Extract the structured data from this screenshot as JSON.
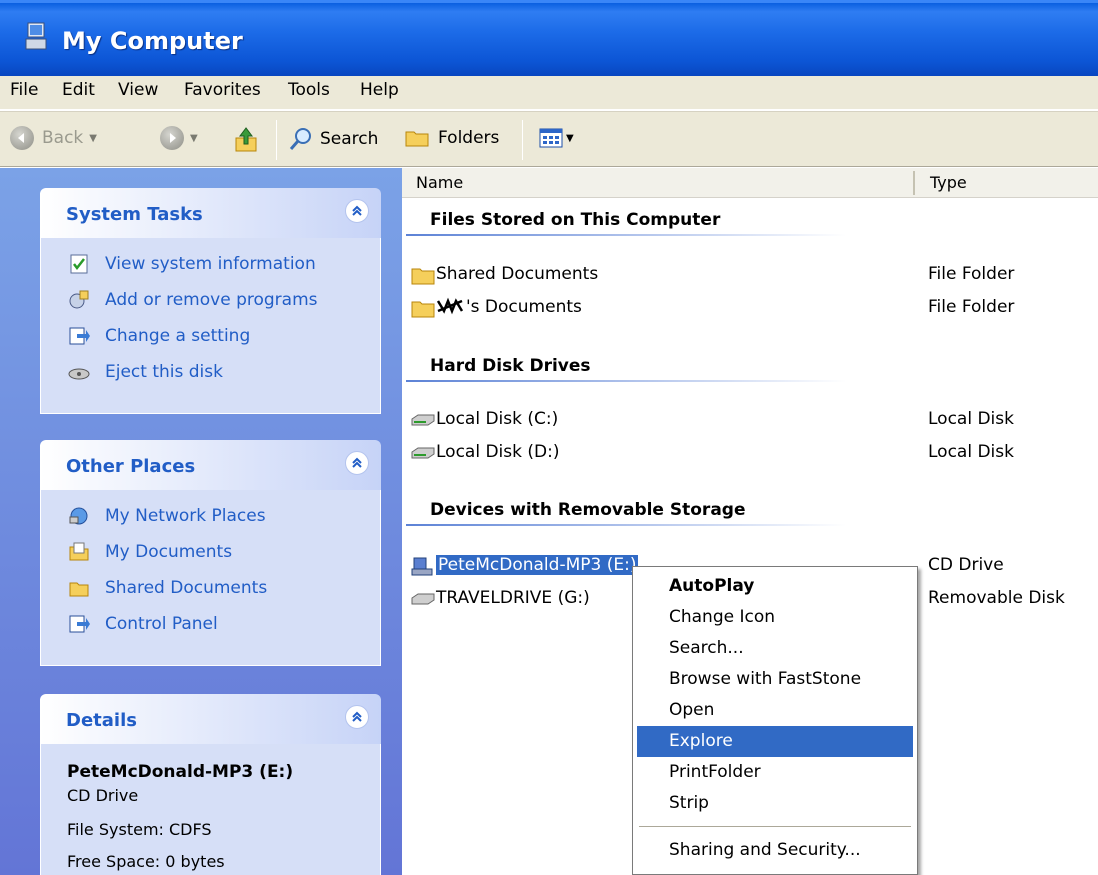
{
  "window": {
    "title": "My Computer"
  },
  "menu": [
    "File",
    "Edit",
    "View",
    "Favorites",
    "Tools",
    "Help"
  ],
  "toolbar": {
    "back": "Back",
    "search": "Search",
    "folders": "Folders"
  },
  "system_tasks": {
    "title": "System Tasks",
    "items": [
      "View system information",
      "Add or remove programs",
      "Change a setting",
      "Eject this disk"
    ]
  },
  "other_places": {
    "title": "Other Places",
    "items": [
      "My Network Places",
      "My Documents",
      "Shared Documents",
      "Control Panel"
    ]
  },
  "details": {
    "title": "Details",
    "name": "PeteMcDonald-MP3 (E:)",
    "kind": "CD Drive",
    "file_system": "File System: CDFS",
    "free_space": "Free Space: 0 bytes"
  },
  "columns": {
    "name": "Name",
    "type": "Type"
  },
  "groups": [
    {
      "title": "Files Stored on This Computer",
      "items": [
        {
          "name": "Shared Documents",
          "type": "File Folder",
          "icon": "folder-icon"
        },
        {
          "name": "'s Documents",
          "type": "File Folder",
          "icon": "folder-icon"
        }
      ]
    },
    {
      "title": "Hard Disk Drives",
      "items": [
        {
          "name": "Local Disk (C:)",
          "type": "Local Disk",
          "icon": "hard-disk-icon"
        },
        {
          "name": "Local Disk (D:)",
          "type": "Local Disk",
          "icon": "hard-disk-icon"
        }
      ]
    },
    {
      "title": "Devices with Removable Storage",
      "items": [
        {
          "name": "PeteMcDonald-MP3 (E:)",
          "type": "CD Drive",
          "icon": "cd-drive-icon",
          "selected": true
        },
        {
          "name": "TRAVELDRIVE (G:)",
          "type": "Removable Disk",
          "icon": "removable-disk-icon"
        }
      ]
    }
  ],
  "context_menu": {
    "items": [
      "AutoPlay",
      "Change Icon",
      "Search...",
      "Browse with FastStone",
      "Open",
      "Explore",
      "PrintFolder",
      "Strip",
      "Sharing and Security..."
    ],
    "highlighted": "Explore"
  },
  "colors": {
    "title_bar": "#0c55d5",
    "task_link": "#215dc6",
    "selection": "#316ac5"
  }
}
